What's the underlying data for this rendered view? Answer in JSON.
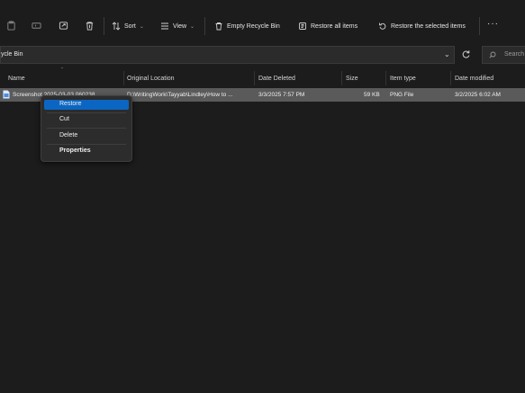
{
  "toolbar": {
    "sort_label": "Sort",
    "view_label": "View",
    "empty_label": "Empty Recycle Bin",
    "restore_all_label": "Restore all items",
    "restore_selected_label": "Restore the selected items",
    "more_label": "···"
  },
  "address": {
    "path": "ycle Bin",
    "search_placeholder": "Search"
  },
  "columns": [
    "Name",
    "Original Location",
    "Date Deleted",
    "Size",
    "Item type",
    "Date modified"
  ],
  "rows": [
    {
      "name": "Screenshot 2025-03-03 060238",
      "location": "D:\\WritingWork\\Tayyab\\Lindley\\How to ...",
      "date_deleted": "3/3/2025 7:57 PM",
      "size": "59 KB",
      "type": "PNG File",
      "date_modified": "3/2/2025 6:02 AM"
    }
  ],
  "context_menu": {
    "restore": "Restore",
    "cut": "Cut",
    "delete": "Delete",
    "properties": "Properties"
  },
  "colors": {
    "accent": "#0b66c3",
    "selected_row": "#5a5a5a",
    "background": "#1c1c1c"
  }
}
